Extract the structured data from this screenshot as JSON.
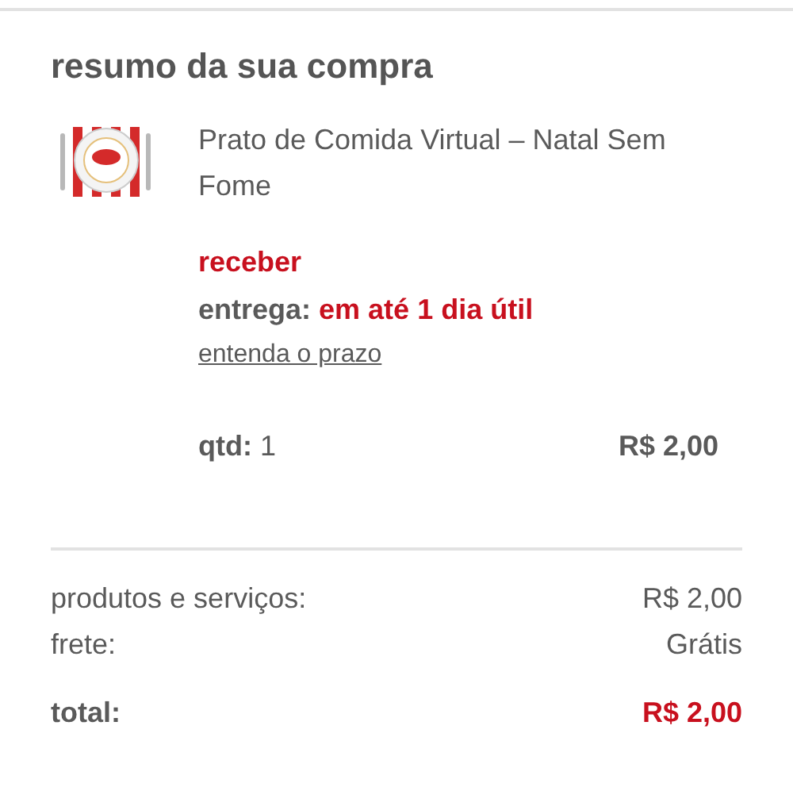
{
  "title": "resumo da sua compra",
  "product": {
    "name": "Prato de Comida Virtual – Natal Sem Fome",
    "status": "receber",
    "delivery": {
      "label": "entrega:",
      "value": "em até 1 dia útil"
    },
    "link": "entenda o prazo",
    "quantity": {
      "label": "qtd:",
      "value": "1"
    },
    "price": "R$ 2,00"
  },
  "summary": [
    {
      "kind": "line",
      "label": "produtos e serviços:",
      "value": "R$ 2,00"
    },
    {
      "kind": "line",
      "label": "frete:",
      "value": "Grátis"
    },
    {
      "kind": "total",
      "label": "total:",
      "value": "R$ 2,00"
    }
  ]
}
